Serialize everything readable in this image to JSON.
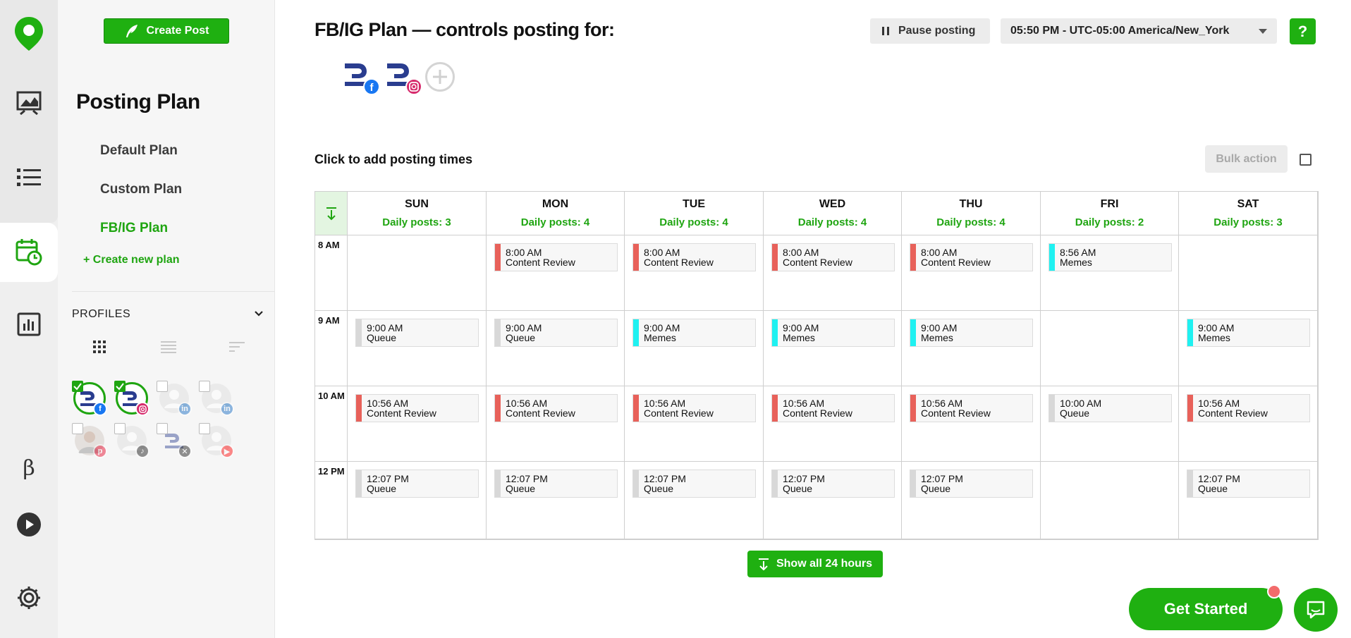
{
  "colors": {
    "brand_green": "#1fb011",
    "content_review": "#e8615a",
    "memes": "#1ff1f1",
    "queue": "#d8d8d8",
    "facebook": "#1877f2",
    "instagram": "#d6296b",
    "linkedin": "#0a66c2",
    "pinterest": "#e60023",
    "tiktok": "#111111",
    "x": "#111111",
    "youtube": "#ff0000"
  },
  "rail": {
    "items": [
      "logo-icon",
      "analytics-image-icon",
      "list-icon",
      "calendar-clock-icon",
      "bar-chart-icon",
      "beta-icon",
      "play-icon",
      "settings-icon"
    ],
    "beta_label": "β"
  },
  "sidebar": {
    "create_post_label": "Create Post",
    "title": "Posting Plan",
    "plans": [
      {
        "label": "Default Plan",
        "active": false
      },
      {
        "label": "Custom Plan",
        "active": false
      },
      {
        "label": "FB/IG Plan",
        "active": true
      }
    ],
    "create_plan_label": "+ Create new plan",
    "profiles_title": "PROFILES",
    "profiles": [
      {
        "network": "facebook",
        "checked": true
      },
      {
        "network": "instagram",
        "checked": true
      },
      {
        "network": "linkedin",
        "checked": false
      },
      {
        "network": "linkedin",
        "checked": false
      },
      {
        "network": "pinterest",
        "checked": false
      },
      {
        "network": "tiktok",
        "checked": false
      },
      {
        "network": "x",
        "checked": false
      },
      {
        "network": "youtube",
        "checked": false
      }
    ]
  },
  "header": {
    "title": "FB/IG Plan — controls posting for:",
    "pause_label": "Pause posting",
    "timezone": "05:50 PM - UTC-05:00 America/New_York",
    "help_label": "?",
    "plan_profiles": [
      "facebook",
      "instagram"
    ]
  },
  "schedule": {
    "instruction": "Click to add posting times",
    "bulk_action_label": "Bulk action",
    "days": [
      {
        "name": "SUN",
        "daily": "Daily posts: 3"
      },
      {
        "name": "MON",
        "daily": "Daily posts: 4"
      },
      {
        "name": "TUE",
        "daily": "Daily posts: 4"
      },
      {
        "name": "WED",
        "daily": "Daily posts: 4"
      },
      {
        "name": "THU",
        "daily": "Daily posts: 4"
      },
      {
        "name": "FRI",
        "daily": "Daily posts: 2"
      },
      {
        "name": "SAT",
        "daily": "Daily posts: 3"
      }
    ],
    "hours": [
      "8 AM",
      "9 AM",
      "10 AM",
      "12 PM"
    ],
    "slots": [
      [
        null,
        {
          "time": "8:00 AM",
          "label": "Content Review",
          "kind": "content_review"
        },
        {
          "time": "8:00 AM",
          "label": "Content Review",
          "kind": "content_review"
        },
        {
          "time": "8:00 AM",
          "label": "Content Review",
          "kind": "content_review"
        },
        {
          "time": "8:00 AM",
          "label": "Content Review",
          "kind": "content_review"
        },
        {
          "time": "8:56 AM",
          "label": "Memes",
          "kind": "memes"
        },
        null
      ],
      [
        {
          "time": "9:00 AM",
          "label": "Queue",
          "kind": "queue"
        },
        {
          "time": "9:00 AM",
          "label": "Queue",
          "kind": "queue"
        },
        {
          "time": "9:00 AM",
          "label": "Memes",
          "kind": "memes"
        },
        {
          "time": "9:00 AM",
          "label": "Memes",
          "kind": "memes"
        },
        {
          "time": "9:00 AM",
          "label": "Memes",
          "kind": "memes"
        },
        null,
        {
          "time": "9:00 AM",
          "label": "Memes",
          "kind": "memes"
        }
      ],
      [
        {
          "time": "10:56 AM",
          "label": "Content Review",
          "kind": "content_review"
        },
        {
          "time": "10:56 AM",
          "label": "Content Review",
          "kind": "content_review"
        },
        {
          "time": "10:56 AM",
          "label": "Content Review",
          "kind": "content_review"
        },
        {
          "time": "10:56 AM",
          "label": "Content Review",
          "kind": "content_review"
        },
        {
          "time": "10:56 AM",
          "label": "Content Review",
          "kind": "content_review"
        },
        {
          "time": "10:00 AM",
          "label": "Queue",
          "kind": "queue"
        },
        {
          "time": "10:56 AM",
          "label": "Content Review",
          "kind": "content_review"
        }
      ],
      [
        {
          "time": "12:07 PM",
          "label": "Queue",
          "kind": "queue"
        },
        {
          "time": "12:07 PM",
          "label": "Queue",
          "kind": "queue"
        },
        {
          "time": "12:07 PM",
          "label": "Queue",
          "kind": "queue"
        },
        {
          "time": "12:07 PM",
          "label": "Queue",
          "kind": "queue"
        },
        {
          "time": "12:07 PM",
          "label": "Queue",
          "kind": "queue"
        },
        null,
        {
          "time": "12:07 PM",
          "label": "Queue",
          "kind": "queue"
        }
      ]
    ],
    "show_all_label": "Show all 24 hours"
  },
  "footer": {
    "get_started_label": "Get Started"
  }
}
